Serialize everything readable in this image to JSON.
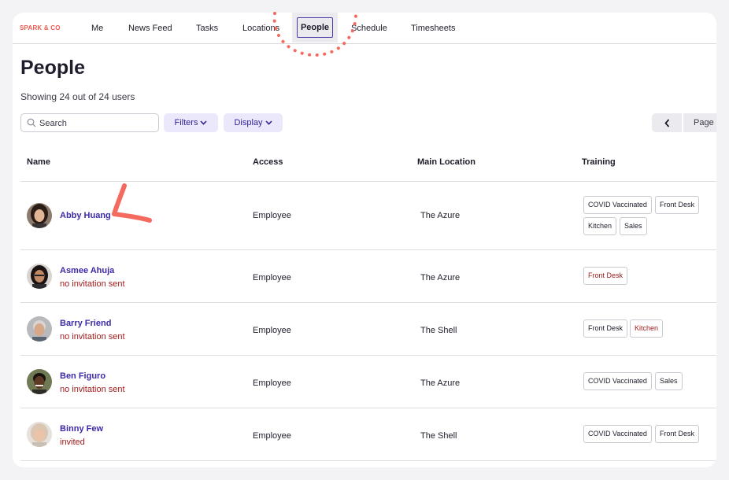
{
  "brand": "SPARK & CO",
  "nav": {
    "items": [
      "Me",
      "News Feed",
      "Tasks",
      "Locations",
      "Schedule",
      "Timesheets"
    ],
    "active": "People"
  },
  "page": {
    "title": "People",
    "subtitle": "Showing 24 out of 24 users"
  },
  "toolbar": {
    "search_placeholder": "Search",
    "search_value": "",
    "filters_label": "Filters",
    "display_label": "Display",
    "page_label": "Page"
  },
  "table": {
    "columns": [
      "Name",
      "Access",
      "Main Location",
      "Training"
    ],
    "rows": [
      {
        "name": "Abby Huang",
        "status": "",
        "access": "Employee",
        "location": "The Azure",
        "training": [
          {
            "label": "COVID Vaccinated",
            "flag": false
          },
          {
            "label": "Front Desk",
            "flag": false
          },
          {
            "label": "Kitchen",
            "flag": false
          },
          {
            "label": "Sales",
            "flag": false
          }
        ]
      },
      {
        "name": "Asmee Ahuja",
        "status": "no invitation sent",
        "access": "Employee",
        "location": "The Azure",
        "training": [
          {
            "label": "Front Desk",
            "flag": true
          }
        ]
      },
      {
        "name": "Barry Friend",
        "status": "no invitation sent",
        "access": "Employee",
        "location": "The Shell",
        "training": [
          {
            "label": "Front Desk",
            "flag": false
          },
          {
            "label": "Kitchen",
            "flag": true
          }
        ]
      },
      {
        "name": "Ben Figuro",
        "status": "no invitation sent",
        "access": "Employee",
        "location": "The Azure",
        "training": [
          {
            "label": "COVID Vaccinated",
            "flag": false
          },
          {
            "label": "Sales",
            "flag": false
          }
        ]
      },
      {
        "name": "Binny Few",
        "status": "invited",
        "access": "Employee",
        "location": "The Shell",
        "training": [
          {
            "label": "COVID Vaccinated",
            "flag": false
          },
          {
            "label": "Front Desk",
            "flag": false
          }
        ]
      }
    ]
  },
  "colors": {
    "accent": "#3a2aa8",
    "warning": "#a11b1b",
    "brand": "#f05a4f",
    "annotation": "#f46a5e"
  },
  "icons": [
    "search-icon",
    "chevron-down-icon",
    "chevron-left-icon"
  ]
}
